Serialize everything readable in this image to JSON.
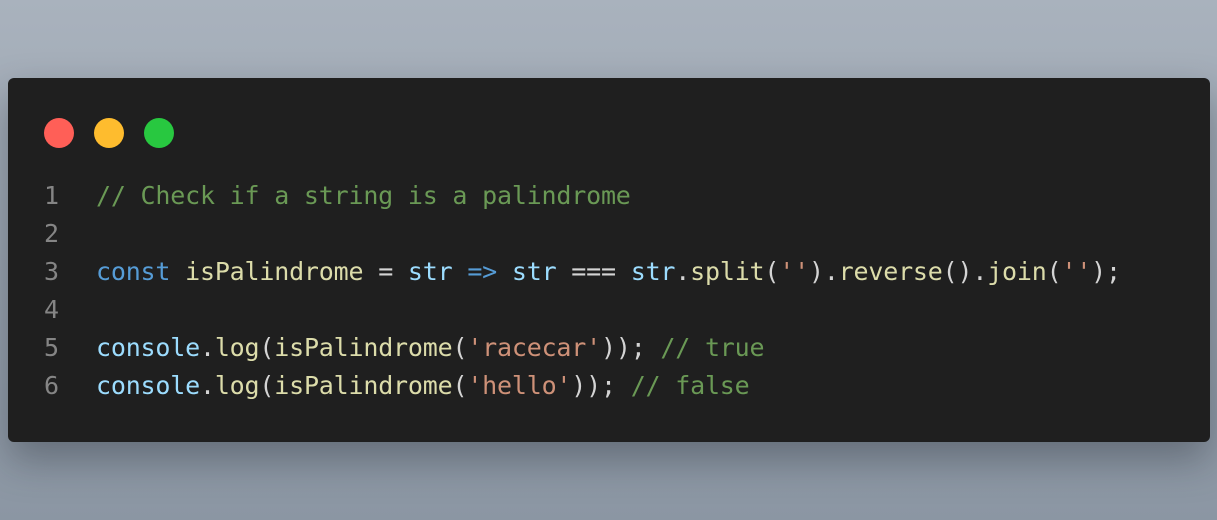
{
  "window": {
    "controls": [
      {
        "name": "close-button",
        "color": "#ff5f57"
      },
      {
        "name": "minimize-button",
        "color": "#febc2e"
      },
      {
        "name": "maximize-button",
        "color": "#28c840"
      }
    ]
  },
  "code": {
    "language": "javascript",
    "lines": [
      {
        "number": "1",
        "tokens": [
          {
            "type": "comment",
            "text": "// Check if a string is a palindrome"
          }
        ]
      },
      {
        "number": "2",
        "tokens": []
      },
      {
        "number": "3",
        "tokens": [
          {
            "type": "keyword",
            "text": "const"
          },
          {
            "type": "op",
            "text": " "
          },
          {
            "type": "func",
            "text": "isPalindrome"
          },
          {
            "type": "op",
            "text": " = "
          },
          {
            "type": "var",
            "text": "str"
          },
          {
            "type": "op",
            "text": " "
          },
          {
            "type": "arrow",
            "text": "=>"
          },
          {
            "type": "op",
            "text": " "
          },
          {
            "type": "var",
            "text": "str"
          },
          {
            "type": "op",
            "text": " === "
          },
          {
            "type": "var",
            "text": "str"
          },
          {
            "type": "punct",
            "text": "."
          },
          {
            "type": "func",
            "text": "split"
          },
          {
            "type": "punct",
            "text": "("
          },
          {
            "type": "string",
            "text": "''"
          },
          {
            "type": "punct",
            "text": ")."
          },
          {
            "type": "func",
            "text": "reverse"
          },
          {
            "type": "punct",
            "text": "()."
          },
          {
            "type": "func",
            "text": "join"
          },
          {
            "type": "punct",
            "text": "("
          },
          {
            "type": "string",
            "text": "''"
          },
          {
            "type": "punct",
            "text": ");"
          }
        ]
      },
      {
        "number": "4",
        "tokens": []
      },
      {
        "number": "5",
        "tokens": [
          {
            "type": "var",
            "text": "console"
          },
          {
            "type": "punct",
            "text": "."
          },
          {
            "type": "func",
            "text": "log"
          },
          {
            "type": "punct",
            "text": "("
          },
          {
            "type": "func",
            "text": "isPalindrome"
          },
          {
            "type": "punct",
            "text": "("
          },
          {
            "type": "string",
            "text": "'racecar'"
          },
          {
            "type": "punct",
            "text": ")); "
          },
          {
            "type": "comment",
            "text": "// true"
          }
        ]
      },
      {
        "number": "6",
        "tokens": [
          {
            "type": "var",
            "text": "console"
          },
          {
            "type": "punct",
            "text": "."
          },
          {
            "type": "func",
            "text": "log"
          },
          {
            "type": "punct",
            "text": "("
          },
          {
            "type": "func",
            "text": "isPalindrome"
          },
          {
            "type": "punct",
            "text": "("
          },
          {
            "type": "string",
            "text": "'hello'"
          },
          {
            "type": "punct",
            "text": ")); "
          },
          {
            "type": "comment",
            "text": "// false"
          }
        ]
      }
    ]
  },
  "colors": {
    "page_background": "#9aa4b0",
    "editor_background": "#1f1f1f",
    "line_number": "#858585",
    "comment": "#6a9955",
    "keyword": "#569cd6",
    "function": "#dcdcaa",
    "variable": "#9cdcfe",
    "string": "#ce9178",
    "punctuation": "#d4d4d4"
  }
}
